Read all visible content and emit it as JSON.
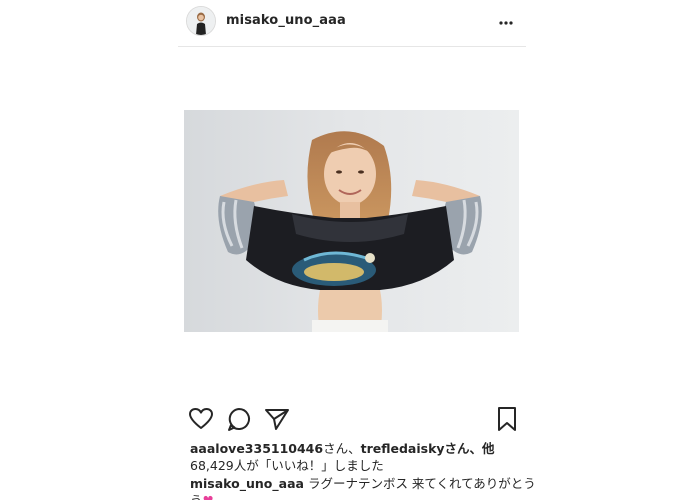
{
  "post": {
    "username": "misako_uno_aaa",
    "liked_by_user1": "aaalove335110446",
    "liked_by_sep1": "さん、",
    "liked_by_user2": "trefledaisky",
    "liked_by_sep2": "さん、他",
    "like_count_text": "68,429人が「いいね！」しました",
    "caption_username": "misako_uno_aaa",
    "caption_text": "ラグーナテンボス 来てくれてありがとう",
    "caption_line2": "う"
  },
  "icons": {
    "more": "more-horizontal-icon",
    "like": "heart-icon",
    "comment": "comment-icon",
    "share": "send-icon",
    "save": "bookmark-icon"
  },
  "colors": {
    "text": "#262626",
    "divider": "#e6e6e6",
    "photo_bg": "#e3e5e7"
  }
}
